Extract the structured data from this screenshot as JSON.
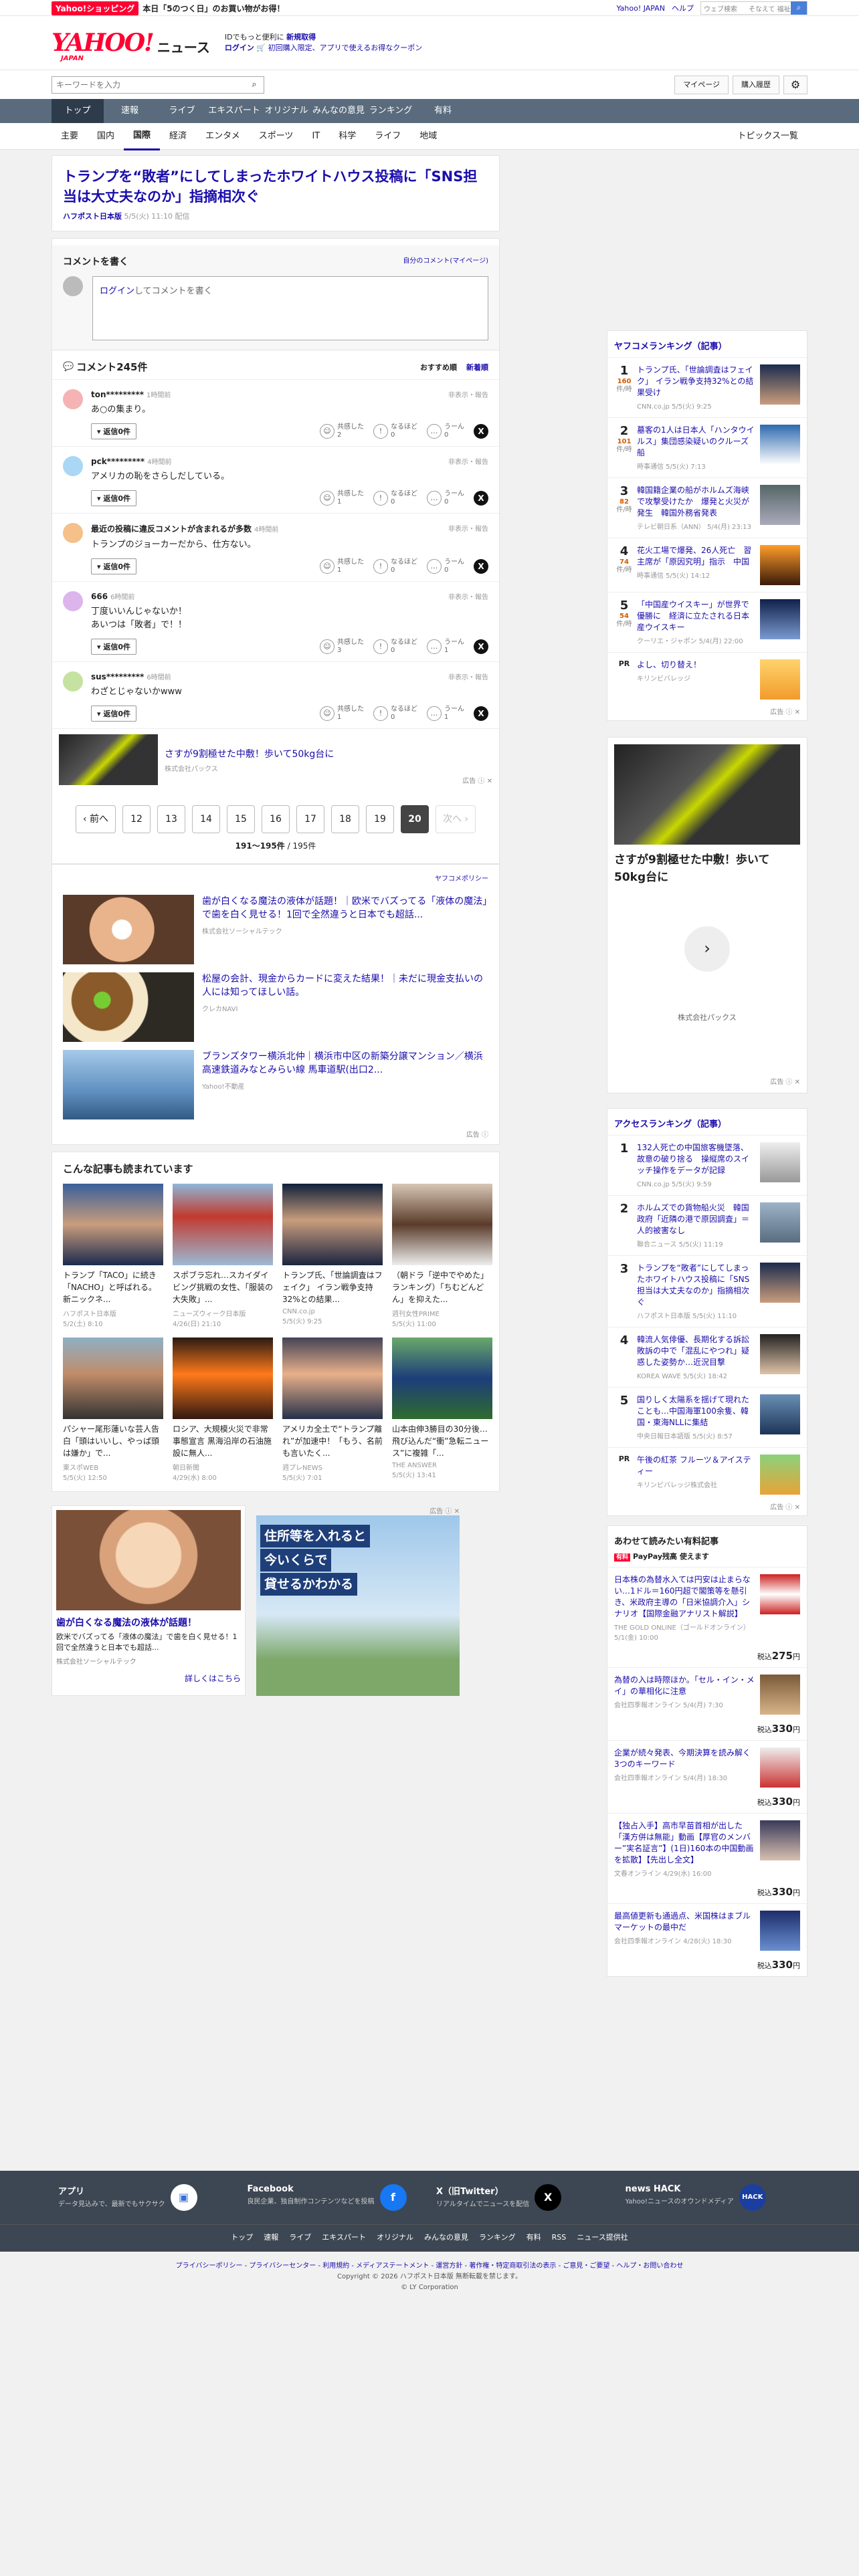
{
  "promo": {
    "badge": "Yahoo!ショッピング",
    "text": "本日「5のつく日」のお買い物がお得！"
  },
  "toplinks": {
    "yahoo": "Yahoo! JAPAN",
    "help": "ヘルプ",
    "web_placeholder": "ウェブ検索",
    "prefecture": "そなえて 福祉..."
  },
  "header": {
    "logo": "YAHOO!",
    "logo_sub": "JAPAN",
    "news": "ニュース",
    "info1_a": "IDでもっと便利に",
    "info1_b": "新規取得",
    "info2_login": "ログイン",
    "info2_coupon": "初回購入限定、アプリで使えるお得なクーポン"
  },
  "search": {
    "placeholder": "キーワードを入力",
    "mypage": "マイページ",
    "history": "購入履歴"
  },
  "nav": [
    "トップ",
    "速報",
    "ライブ",
    "エキスパート",
    "オリジナル",
    "みんなの意見",
    "ランキング",
    "有料"
  ],
  "subnav": [
    "主要",
    "国内",
    "国際",
    "経済",
    "エンタメ",
    "スポーツ",
    "IT",
    "科学",
    "ライフ",
    "地域"
  ],
  "subnav_topics": "トピックス一覧",
  "article": {
    "title": "トランプを“敗者”にしてしまったホワイトハウス投稿に「SNS担当は大丈夫なのか」指摘相次ぐ",
    "source": "ハフポスト日本版",
    "date": "5/5(火) 11:10 配信"
  },
  "comment_write": {
    "title": "コメントを書く",
    "mine": "自分のコメント(マイページ)",
    "login": "ログイン",
    "box": "してコメントを書く"
  },
  "comment_list": {
    "title": "コメント245件",
    "sort_rec": "おすすめ順",
    "sort_new": "新着順"
  },
  "comments": [
    {
      "user": "ton*********",
      "time": "1時間前",
      "text": "あ○の集まり。",
      "k": "2",
      "n": "0",
      "u": "0",
      "color": "#f6b3b3"
    },
    {
      "user": "pck*********",
      "time": "4時間前",
      "text": "アメリカの恥をさらしだしている。",
      "k": "1",
      "n": "0",
      "u": "0",
      "color": "#a9d7f5"
    },
    {
      "user": "最近の投稿に違反コメントが含まれるが多数",
      "time": "4時間前",
      "text": "トランプのジョーカーだから、仕方ない。",
      "k": "1",
      "n": "0",
      "u": "0",
      "color": "#f5c08a"
    },
    {
      "user": "666",
      "time": "6時間前",
      "text": "丁度いいんじゃないか！\nあいつは「敗者」で！！",
      "k": "3",
      "n": "0",
      "u": "1",
      "color": "#dcb5ec"
    },
    {
      "user": "sus*********",
      "time": "6時間前",
      "text": "わざとじゃないかwww",
      "k": "1",
      "n": "0",
      "u": "1",
      "color": "#c6e2a0"
    }
  ],
  "comment_labels": {
    "flag": "非表示・報告",
    "reply": "返信0件",
    "kyokan": "共感した",
    "naruhodo": "なるほど",
    "uun": "うーん"
  },
  "ad_strip": {
    "title": "さすが9割極せた中敷！歩いて50kg台に",
    "sponsor": "株式会社パックス",
    "label": "広告 ⓘ ✕"
  },
  "pager": {
    "prev": "前へ",
    "pages": [
      "12",
      "13",
      "14",
      "15",
      "16",
      "17",
      "18",
      "19",
      "20"
    ],
    "current": "20",
    "next": "次へ",
    "count_a": "191〜195件",
    "count_b": " / 195件"
  },
  "policy": "ヤフコメポリシー",
  "ads": [
    {
      "title": "歯が白くなる魔法の液体が話題！｜欧米でバズってる「液体の魔法」で歯を白く見せる！1回で全然違うと日本でも超話...",
      "sponsor": "株式会社ソーシャルテック"
    },
    {
      "title": "松屋の会計、現金からカードに変えた結果！｜未だに現金支払いの人には知ってほしい話。",
      "sponsor": "クレカNAVI"
    },
    {
      "title": "ブランズタワー横浜北仲｜横浜市中区の新築分譲マンション／横浜高速鉄道みなとみらい線 馬車道駅(出口2...",
      "sponsor": "Yahoo!不動産"
    }
  ],
  "ad_label": "広告 ⓘ",
  "related": {
    "title": "こんな記事も読まれています",
    "items": [
      {
        "t": "トランプ「TACO」に続き「NACHO」と呼ばれる。新ニックネ...",
        "s": "ハフポスト日本版",
        "d": "5/2(土) 8:10"
      },
      {
        "t": "スポブラ忘れ…スカイダイビング挑戦の女性、「服装の大失敗」...",
        "s": "ニューズウィーク日本版",
        "d": "4/26(日) 21:10"
      },
      {
        "t": "トランプ氏、「世論調査はフェイク」 イラン戦争支持32%との結果...",
        "s": "CNN.co.jp",
        "d": "5/5(火) 9:25"
      },
      {
        "t": "（朝ドラ「逆中でやめた」ランキング）「ちむどんどん」を抑えた...",
        "s": "週刊女性PRIME",
        "d": "5/5(火) 11:00"
      },
      {
        "t": "パシャー尾形蓮いな芸人告白「頭はいいし、やっぱ頭は嫌か」で...",
        "s": "東スポWEB",
        "d": "5/5(火) 12:50"
      },
      {
        "t": "ロシア、大規模火災で非常事態宣言 黒海沿岸の石油施設に無人...",
        "s": "朝日新聞",
        "d": "4/29(水) 8:00"
      },
      {
        "t": "アメリカ全土で“トランプ離れ”が加速中！「もう、名前も言いたく...",
        "s": "週プレNEWS",
        "d": "5/5(火) 7:01"
      },
      {
        "t": "山本由伸3勝目の30分後…飛び込んだ“衝”急転ニュース”に複雑「...",
        "s": "THE ANSWER",
        "d": "5/5(火) 13:41"
      }
    ]
  },
  "bottom_ads": {
    "a_title": "歯が白くなる魔法の液体が話題！",
    "a_desc": "欧米でバズってる「液体の魔法」で歯を白く見せる！1回で全然違うと日本でも超話...",
    "a_sponsor": "株式会社ソーシャルテック",
    "a_more": "詳しくはこちら",
    "b_l1": "住所等を入れると",
    "b_l2": "今いくらで",
    "b_l3": "貸せるかわかる",
    "label": "広告 ⓘ ✕"
  },
  "ranking": {
    "title": "ヤフコメランキング（記事）",
    "unit": "件/時",
    "items": [
      {
        "n": "1",
        "c": "160",
        "t": "トランプ氏、「世論調査はフェイク」 イラン戦争支持32%との結果受け",
        "s": "CNN.co.jp 5/5(火) 9:25"
      },
      {
        "n": "2",
        "c": "101",
        "t": "墓客の1人は日本人「ハンタウイルス」集団感染疑いのクルーズ船",
        "s": "時事通信 5/5(火) 7:13"
      },
      {
        "n": "3",
        "c": "82",
        "t": "韓国籍企業の船がホルムズ海峡で攻撃受けたか　爆発と火災が発生　韓国外務省発表",
        "s": "テレビ朝日系（ANN） 5/4(月) 23:13"
      },
      {
        "n": "4",
        "c": "74",
        "t": "花火工場で爆発、26人死亡　習主席が「原因究明」指示　中国",
        "s": "時事通信 5/5(火) 14:12"
      },
      {
        "n": "5",
        "c": "54",
        "t": "「中国産ウイスキー」が世界で優勝に　経済に立たされる日本産ウイスキー",
        "s": "クーリエ・ジャポン 5/4(月) 22:00"
      }
    ],
    "pr_t": "よし、切り替え！",
    "pr_s": "キリンビバレッジ",
    "pr": "PR",
    "label": "広告 ⓘ ✕"
  },
  "right_ad": {
    "title": "さすが9割極せた中敷！歩いて50kg台に",
    "sponsor": "株式会社パックス",
    "label": "広告 ⓘ ✕"
  },
  "access": {
    "title": "アクセスランキング（記事）",
    "items": [
      {
        "n": "1",
        "t": "132人死亡の中国旅客機墜落、故意の破り捨る　操縦席のスイッチ操作をデータが記録",
        "s": "CNN.co.jp 5/5(火) 9:59"
      },
      {
        "n": "2",
        "t": "ホルムズでの貨物船火災　韓国政府「近隣の港で原因調査」＝人的被害なし",
        "s": "聯合ニュース 5/5(火) 11:19"
      },
      {
        "n": "3",
        "t": "トランプを“敗者”にしてしまったホワイトハウス投稿に「SNS担当は大丈夫なのか」指摘相次ぐ",
        "s": "ハフポスト日本版 5/5(火) 11:10"
      },
      {
        "n": "4",
        "t": "韓流人気俳優、長期化する訴訟敗訴の中で「混乱にやつれ」疑惑した姿勢か…近況目撃",
        "s": "KOREA WAVE 5/5(火) 18:42"
      },
      {
        "n": "5",
        "t": "国りしく太陽系を揺げて現れたことも…中国海軍100余隻、韓国・東海NLLに集結",
        "s": "中央日報日本語版 5/5(火) 8:57"
      }
    ],
    "pr_t": "午後の紅茶 フルーツ＆アイスティー",
    "pr_s": "キリンビバレッジ株式会社",
    "pr": "PR",
    "label": "広告 ⓘ ✕"
  },
  "paid": {
    "title": "あわせて読みたい有料記事",
    "badge": "有料",
    "sub": "PayPay残高 使えます",
    "items": [
      {
        "t": "日本株の為替水入ては円安は止まらない…1ドル＝160円超で閣策等を懸引き、米政府主導の「日米協調介入」シナリオ【国際金融アナリスト解説】",
        "s": "THE GOLD ONLINE（ゴールドオンライン） 5/1(金) 10:00",
        "p": "275"
      },
      {
        "t": "為替の入は時際ほか。「セル・イン・メイ」の華相化に注意",
        "s": "会社四季報オンライン 5/4(月) 7:30",
        "p": "330"
      },
      {
        "t": "企業が続々発表、今期決算を読み解く3つのキーワード",
        "s": "会社四季報オンライン 5/4(月) 18:30",
        "p": "330"
      },
      {
        "t": "【独占入手】高市早苗首相が出した「漢方併は無能」動画【厚官のメンバー”実名証言”】(1日)160本の中国動画を拡散】【先出し全文】",
        "s": "文春オンライン 4/29(水) 16:00",
        "p": "330"
      },
      {
        "t": "最高値更新も通過点、米国株はまブルマーケットの最中だ",
        "s": "会社四季報オンライン 4/28(火) 18:30",
        "p": "330"
      }
    ],
    "price_prefix": "税込",
    "price_suffix": "円"
  },
  "footer": {
    "cols": [
      {
        "h": "アプリ",
        "d": "データ見込みで、最新でもサクサク",
        "ic": "▣"
      },
      {
        "h": "Facebook",
        "d": "良民企業、独自制作コンテンツなどを投稿",
        "ic": "f"
      },
      {
        "h": "X（旧Twitter）",
        "d": "リアルタイムでニュースを配信",
        "ic": "X"
      },
      {
        "h": "news HACK",
        "d": "Yahoo!ニュースのオウンドメディア",
        "ic": "HACK"
      }
    ],
    "nav": [
      "トップ",
      "速報",
      "ライブ",
      "エキスパート",
      "オリジナル",
      "みんなの意見",
      "ランキング",
      "有料",
      "RSS",
      "ニュース提供社"
    ],
    "links": "プライバシーポリシー - プライバシーセンター - 利用規約 - メディアステートメント - 運営方針 - 著作権・特定商取引法の表示 - ご意見・ご要望 - ヘルプ・お問い合わせ",
    "copy": "Copyright © 2026 ハフポスト日本版 無断転載を禁じます。",
    "ly": "© LY Corporation"
  }
}
